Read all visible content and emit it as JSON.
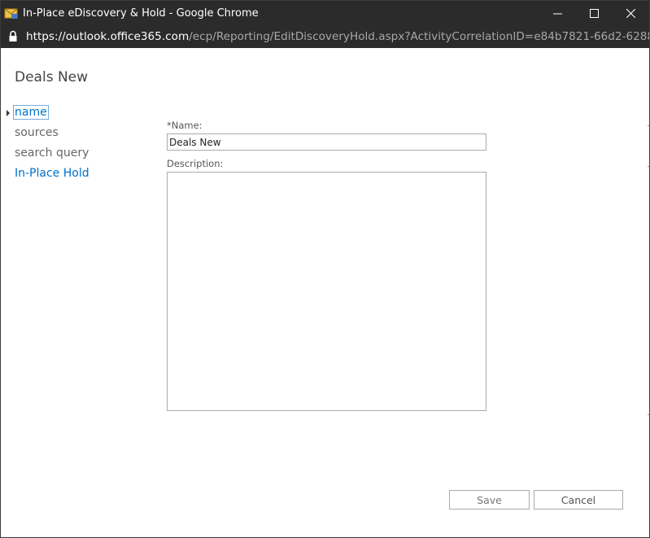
{
  "window": {
    "title": "In-Place eDiscovery & Hold - Google Chrome",
    "controls": {
      "minimize": "minimize",
      "maximize": "maximize",
      "close": "close"
    }
  },
  "addressbar": {
    "url_host": "https://outlook.office365.com",
    "url_path": "/ecp/Reporting/EditDiscoveryHold.aspx?ActivityCorrelationID=e84b7821-66d2-6288-2946..."
  },
  "page": {
    "title": "Deals New"
  },
  "nav": {
    "items": [
      {
        "label": "name",
        "state": "active"
      },
      {
        "label": "sources",
        "state": "normal"
      },
      {
        "label": "search query",
        "state": "normal"
      },
      {
        "label": "In-Place Hold",
        "state": "link"
      }
    ]
  },
  "form": {
    "name_label": "*Name:",
    "name_value": "Deals New",
    "description_label": "Description:",
    "description_value": ""
  },
  "buttons": {
    "save_label": "Save",
    "cancel_label": "Cancel"
  },
  "colors": {
    "titlebar": "#2b2b2b",
    "link": "#0072c6",
    "border": "#ababab"
  }
}
